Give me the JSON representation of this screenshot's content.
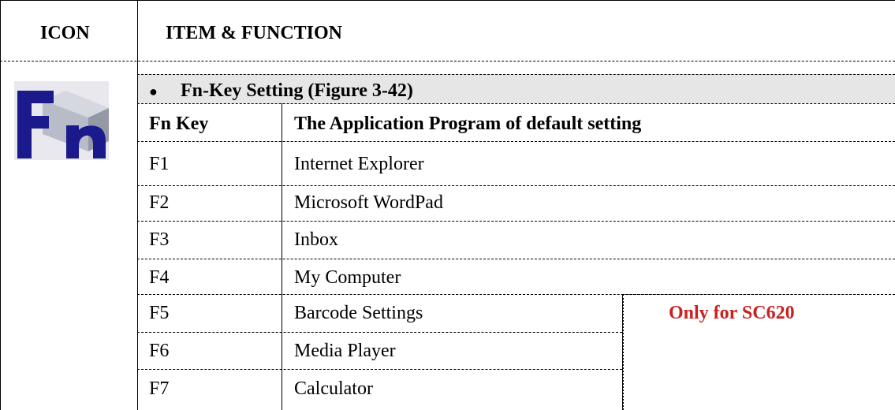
{
  "header": {
    "icon_col": "ICON",
    "item_col": "ITEM & FUNCTION"
  },
  "section": {
    "bullet": "●",
    "title": "Fn-Key Setting (Figure 3-42)"
  },
  "icon": {
    "name": "fn-key-icon",
    "glyph_main": "F",
    "glyph_sub": "n",
    "color": "#1a1a8c"
  },
  "table": {
    "col_key": "Fn Key",
    "col_program": "The Application Program of default setting",
    "rows": [
      {
        "key": "F1",
        "program": "Internet Explorer"
      },
      {
        "key": "F2",
        "program": "Microsoft WordPad"
      },
      {
        "key": "F3",
        "program": "Inbox"
      },
      {
        "key": "F4",
        "program": "My Computer"
      },
      {
        "key": "F5",
        "program": "Barcode Settings"
      },
      {
        "key": "F6",
        "program": "Media Player"
      },
      {
        "key": "F7",
        "program": "Calculator"
      }
    ],
    "note": "Only for SC620",
    "note_color": "#cc1f1f"
  },
  "colors": {
    "section_bg": "#e6e6e6",
    "line": "#000000"
  }
}
